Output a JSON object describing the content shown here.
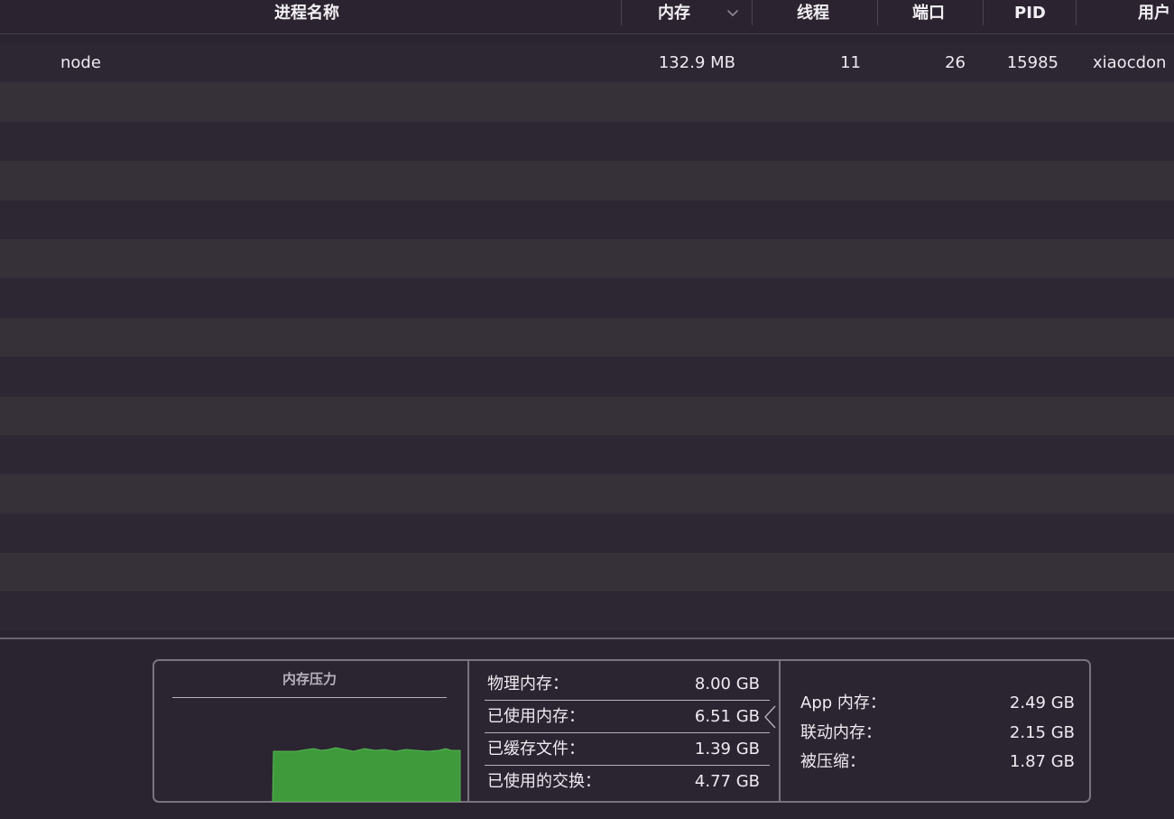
{
  "header": {
    "columns": {
      "name": "进程名称",
      "memory": "内存",
      "threads": "线程",
      "ports": "端口",
      "pid": "PID",
      "user": "用户"
    },
    "sort_icon": "chevron-down-icon"
  },
  "processes": [
    {
      "name": "node",
      "memory": "132.9 MB",
      "threads": "11",
      "ports": "26",
      "pid": "15985",
      "user": "xiaocdon"
    }
  ],
  "memory_panel": {
    "pressure": {
      "title": "内存压力",
      "level_color": "#3f9a3c"
    },
    "stats": [
      {
        "label": "物理内存：",
        "value": "8.00 GB"
      },
      {
        "label": "已使用内存：",
        "value": "6.51 GB"
      },
      {
        "label": "已缓存文件：",
        "value": "1.39 GB"
      },
      {
        "label": "已使用的交换：",
        "value": "4.77 GB"
      }
    ],
    "details": [
      {
        "label": "App 内存：",
        "value": "2.49 GB"
      },
      {
        "label": "联动内存：",
        "value": "2.15 GB"
      },
      {
        "label": "被压缩：",
        "value": "1.87 GB"
      }
    ]
  }
}
